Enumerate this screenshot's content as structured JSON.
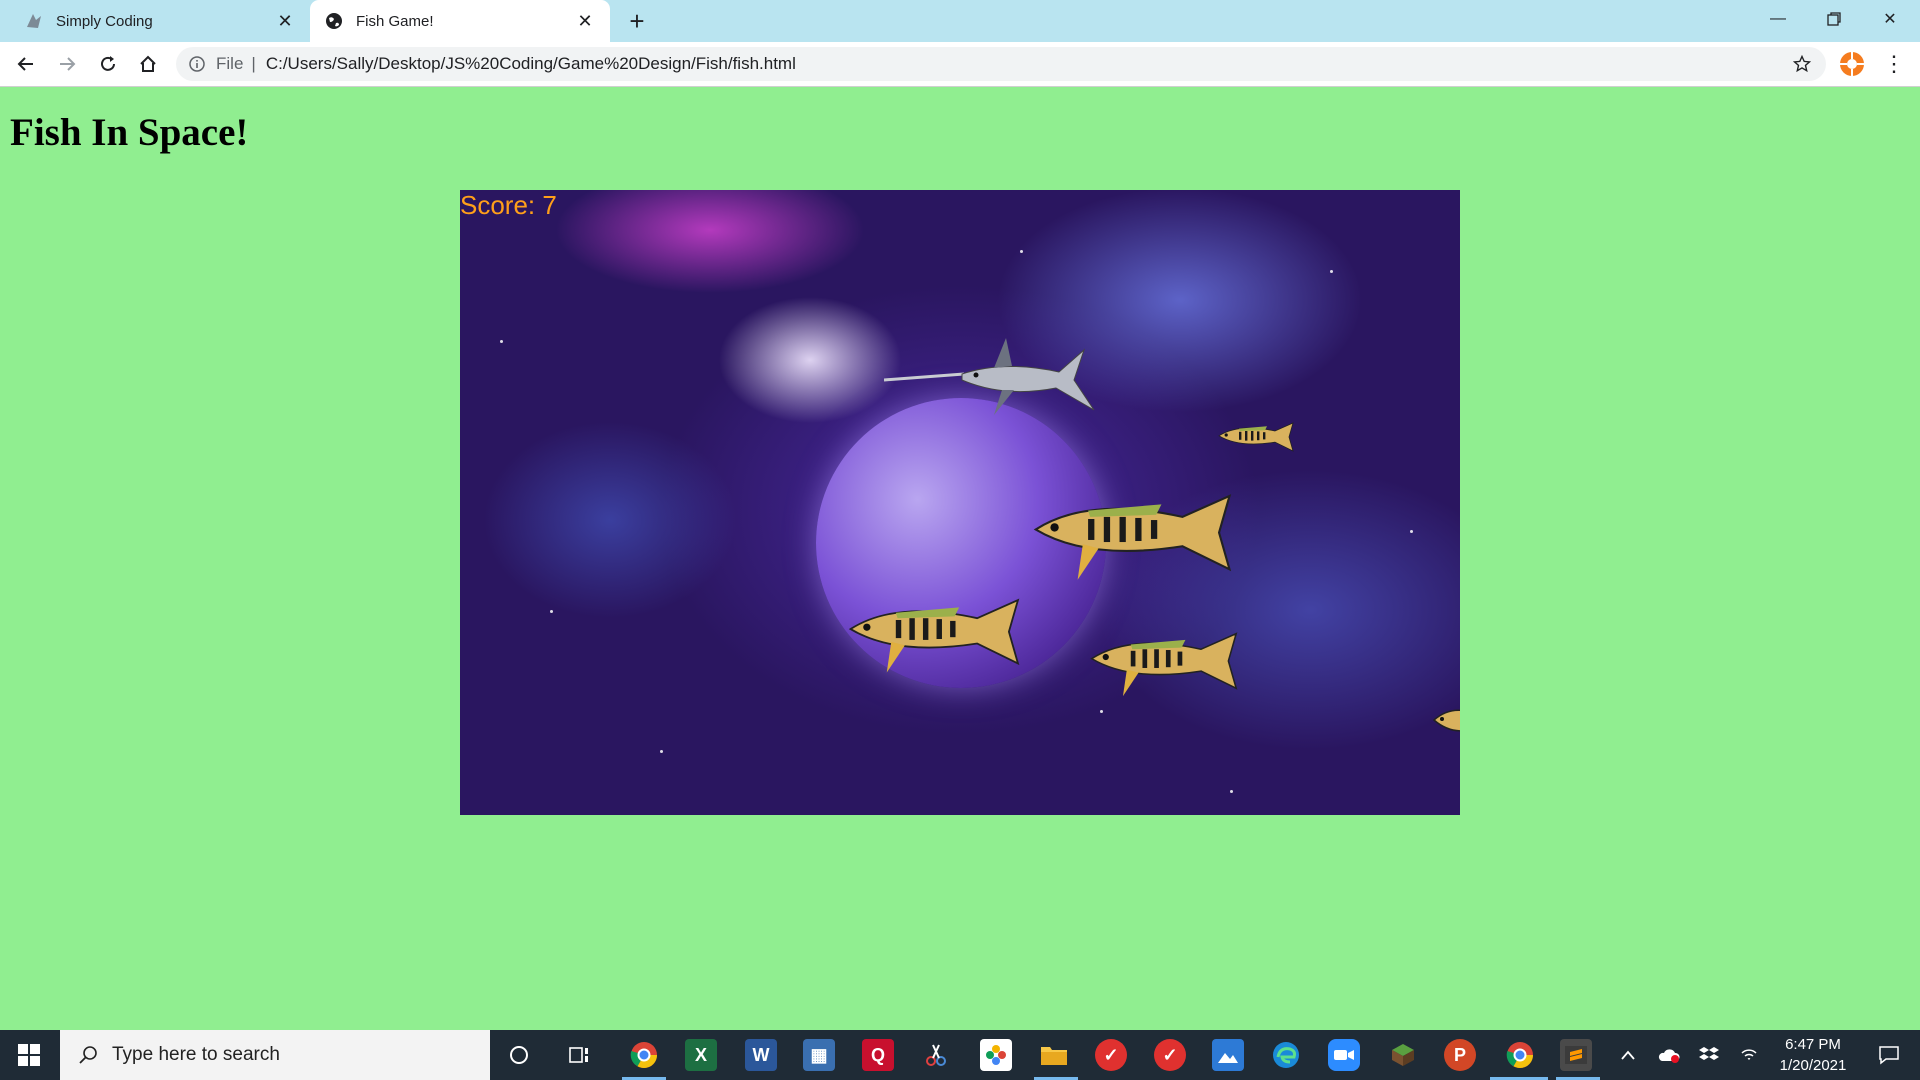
{
  "browser": {
    "tabs": [
      {
        "title": "Simply Coding",
        "active": false,
        "favicon": "simply-coding-logo"
      },
      {
        "title": "Fish Game!",
        "active": true,
        "favicon": "globe-icon"
      }
    ],
    "address": {
      "scheme": "File",
      "url": "C:/Users/Sally/Desktop/JS%20Coding/Game%20Design/Fish/fish.html"
    }
  },
  "page": {
    "heading": "Fish In Space!",
    "background": "#90EE90",
    "game": {
      "score_text": "Score: 7",
      "score_color": "#ff9f1a",
      "sprites": [
        "swordfish",
        "killifish",
        "killifish",
        "killifish",
        "killifish",
        "killifish"
      ]
    }
  },
  "taskbar": {
    "search_placeholder": "Type here to search",
    "apps": [
      "cortana-icon",
      "task-view-icon",
      "chrome-icon",
      "excel-icon",
      "word-icon",
      "calculator-icon",
      "quicken-icon",
      "snip-icon",
      "photos-icon",
      "file-explorer-icon",
      "todo-icon",
      "todo-icon",
      "photos-icon",
      "edge-icon",
      "zoom-icon",
      "minecraft-icon",
      "powerpoint-icon",
      "chrome-icon",
      "sublime-icon"
    ],
    "time": "6:47 PM",
    "date": "1/20/2021"
  }
}
